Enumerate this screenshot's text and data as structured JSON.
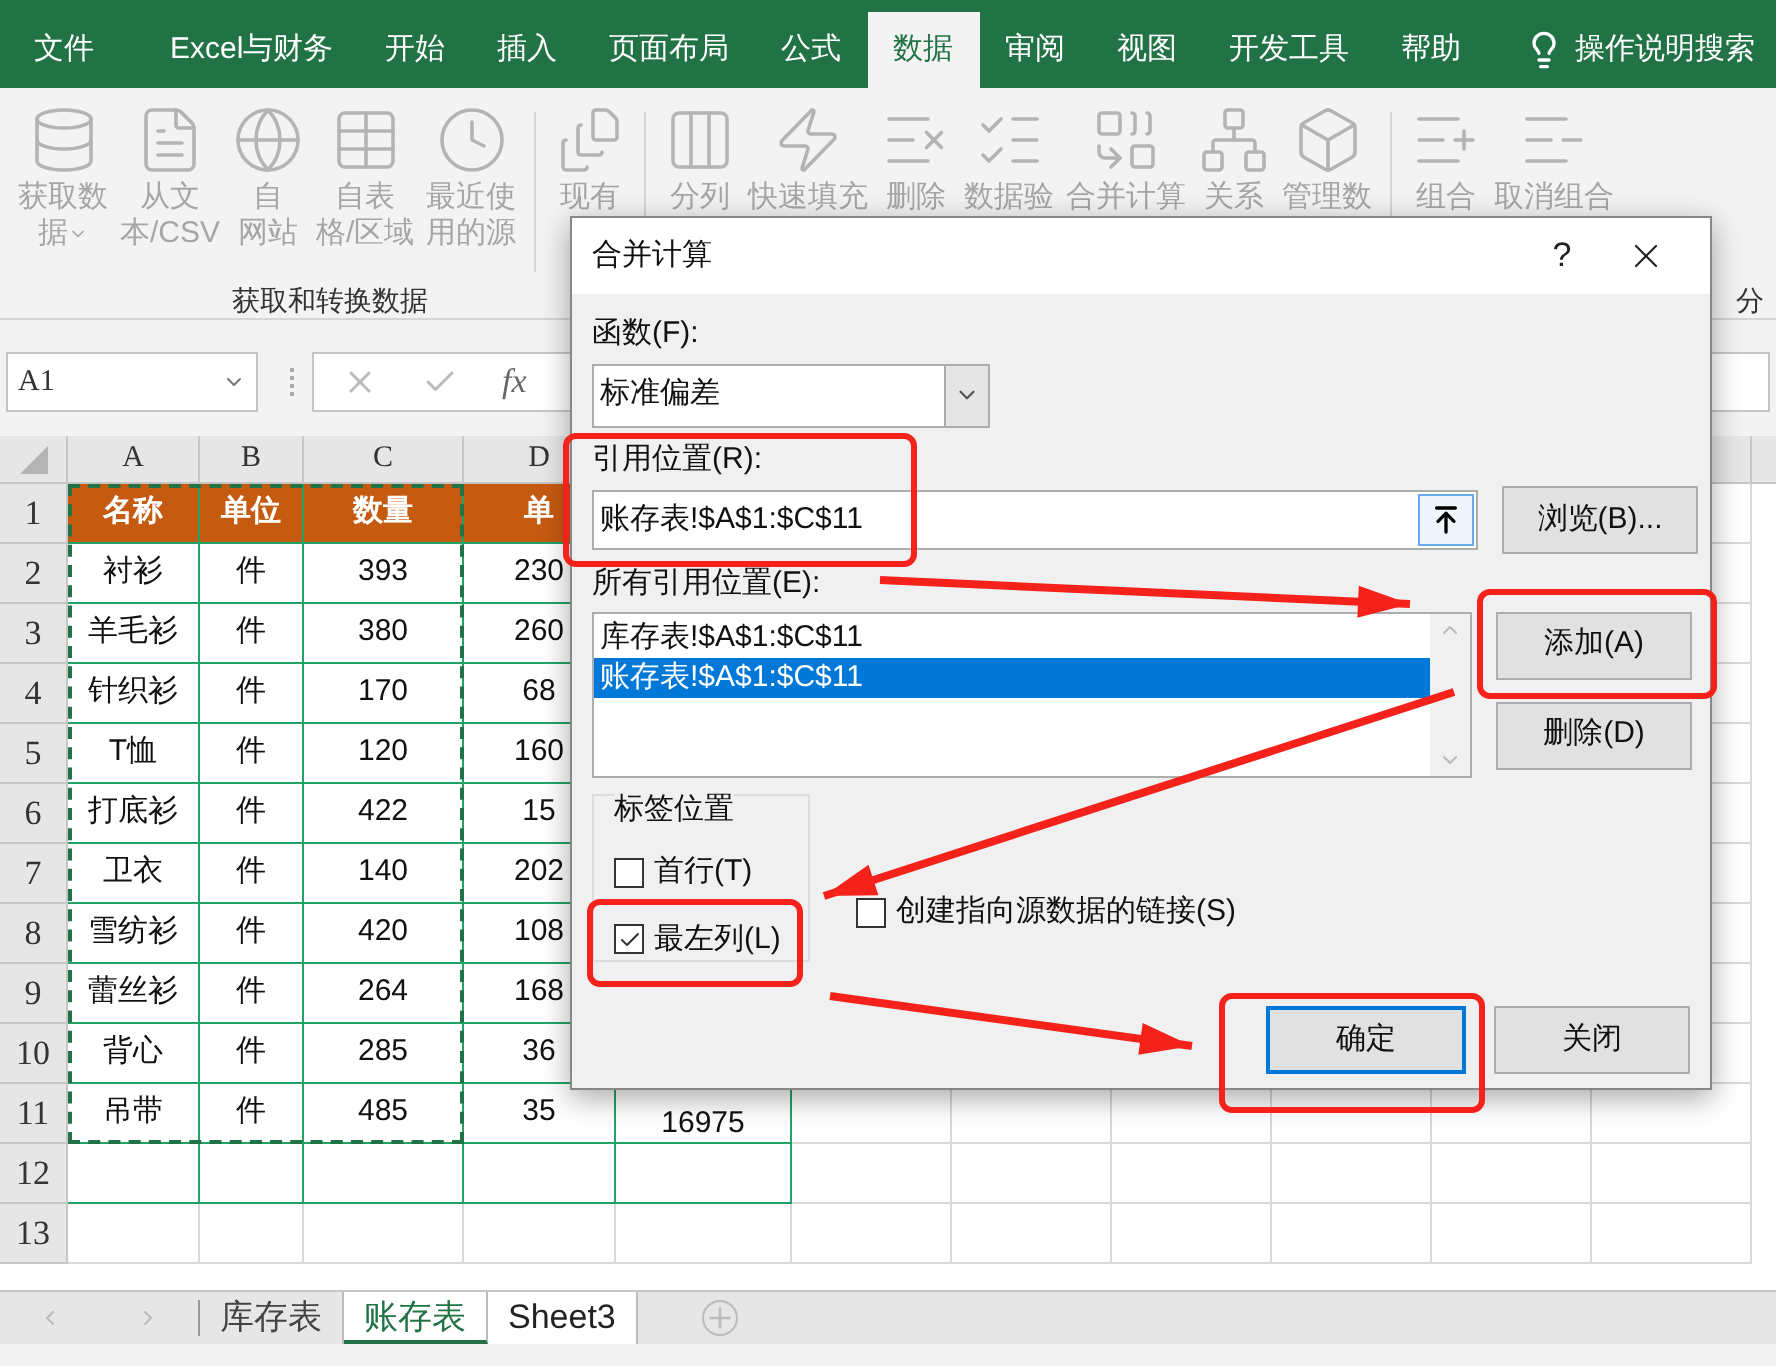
{
  "menu_tabs": [
    {
      "label": "文件",
      "selected": false
    },
    {
      "label": "Excel与财务",
      "selected": false
    },
    {
      "label": "开始",
      "selected": false
    },
    {
      "label": "插入",
      "selected": false
    },
    {
      "label": "页面布局",
      "selected": false
    },
    {
      "label": "公式",
      "selected": false
    },
    {
      "label": "数据",
      "selected": true
    },
    {
      "label": "审阅",
      "selected": false
    },
    {
      "label": "视图",
      "selected": false
    },
    {
      "label": "开发工具",
      "selected": false
    },
    {
      "label": "帮助",
      "selected": false
    }
  ],
  "tell_me": "操作说明搜索",
  "ribbon": {
    "buttons": [
      {
        "kind": "database",
        "lines": [
          "获取数",
          "据"
        ],
        "dropdown": true
      },
      {
        "kind": "file",
        "lines": [
          "从文",
          "本/CSV"
        ],
        "dropdown": false
      },
      {
        "kind": "web",
        "lines": [
          "自",
          "网站"
        ],
        "dropdown": false
      },
      {
        "kind": "table",
        "lines": [
          "自表",
          "格/区域"
        ],
        "dropdown": false
      },
      {
        "kind": "recent",
        "lines": [
          "最近使",
          "用的源"
        ],
        "dropdown": false
      },
      {
        "kind": "existing",
        "lines": [
          "现有"
        ],
        "dropdown": false
      },
      {
        "kind": "split",
        "lines": [
          "分列"
        ],
        "dropdown": false
      },
      {
        "kind": "flash",
        "lines": [
          "快速填充"
        ],
        "dropdown": false
      },
      {
        "kind": "dedupe",
        "lines": [
          "删除"
        ],
        "dropdown": false
      },
      {
        "kind": "validate",
        "lines": [
          "数据验"
        ],
        "dropdown": false
      },
      {
        "kind": "consolidate",
        "lines": [
          "合并计算"
        ],
        "dropdown": false
      },
      {
        "kind": "relations",
        "lines": [
          "关系"
        ],
        "dropdown": false
      },
      {
        "kind": "model",
        "lines": [
          "管理数"
        ],
        "dropdown": false
      },
      {
        "kind": "group",
        "lines": [
          "组合"
        ],
        "dropdown": false
      },
      {
        "kind": "ungroup",
        "lines": [
          "取消组合"
        ],
        "dropdown": false
      }
    ],
    "group_labels": [
      "获取和转换数据",
      "分"
    ]
  },
  "formula_bar": {
    "name_box": "A1",
    "function_label": "fx"
  },
  "sheet": {
    "columns": [
      "A",
      "B",
      "C",
      "D"
    ],
    "rows": [
      {
        "number": "1",
        "kind": "header",
        "cells": [
          "名称",
          "单位",
          "数量",
          "单"
        ]
      },
      {
        "number": "2",
        "kind": "data",
        "cells": [
          "衬衫",
          "件",
          "393",
          "230"
        ]
      },
      {
        "number": "3",
        "kind": "data",
        "cells": [
          "羊毛衫",
          "件",
          "380",
          "260"
        ]
      },
      {
        "number": "4",
        "kind": "data",
        "cells": [
          "针织衫",
          "件",
          "170",
          "68"
        ]
      },
      {
        "number": "5",
        "kind": "data",
        "cells": [
          "T恤",
          "件",
          "120",
          "160"
        ]
      },
      {
        "number": "6",
        "kind": "data",
        "cells": [
          "打底衫",
          "件",
          "422",
          "15"
        ]
      },
      {
        "number": "7",
        "kind": "data",
        "cells": [
          "卫衣",
          "件",
          "140",
          "202"
        ]
      },
      {
        "number": "8",
        "kind": "data",
        "cells": [
          "雪纺衫",
          "件",
          "420",
          "108"
        ]
      },
      {
        "number": "9",
        "kind": "data",
        "cells": [
          "蕾丝衫",
          "件",
          "264",
          "168"
        ]
      },
      {
        "number": "10",
        "kind": "data",
        "cells": [
          "背心",
          "件",
          "285",
          "36"
        ]
      },
      {
        "number": "11",
        "kind": "data",
        "cells": [
          "吊带",
          "件",
          "485",
          "35",
          "16975"
        ]
      },
      {
        "number": "12",
        "kind": "empty",
        "cells": []
      },
      {
        "number": "13",
        "kind": "empty",
        "cells": []
      }
    ]
  },
  "dialog": {
    "title": "合并计算",
    "help": "?",
    "function": {
      "label": "函数(F):",
      "value": "标准偏差"
    },
    "reference": {
      "label": "引用位置(R):",
      "value": "账存表!$A$1:$C$11"
    },
    "browse_button": "浏览(B)...",
    "all_references": {
      "label": "所有引用位置(E):",
      "items": [
        {
          "text": "库存表!$A$1:$C$11",
          "selected": false
        },
        {
          "text": "账存表!$A$1:$C$11",
          "selected": true
        }
      ]
    },
    "add_button": "添加(A)",
    "delete_button": "删除(D)",
    "label_position": {
      "title": "标签位置",
      "options": [
        {
          "label": "首行(T)",
          "checked": false
        },
        {
          "label": "最左列(L)",
          "checked": true
        }
      ]
    },
    "link_option": {
      "label": "创建指向源数据的链接(S)",
      "checked": false
    },
    "ok_button": "确定",
    "close_button": "关闭"
  },
  "sheet_tabs": [
    {
      "label": "库存表",
      "selected": false
    },
    {
      "label": "账存表",
      "selected": true
    },
    {
      "label": "Sheet3",
      "selected": false
    }
  ]
}
